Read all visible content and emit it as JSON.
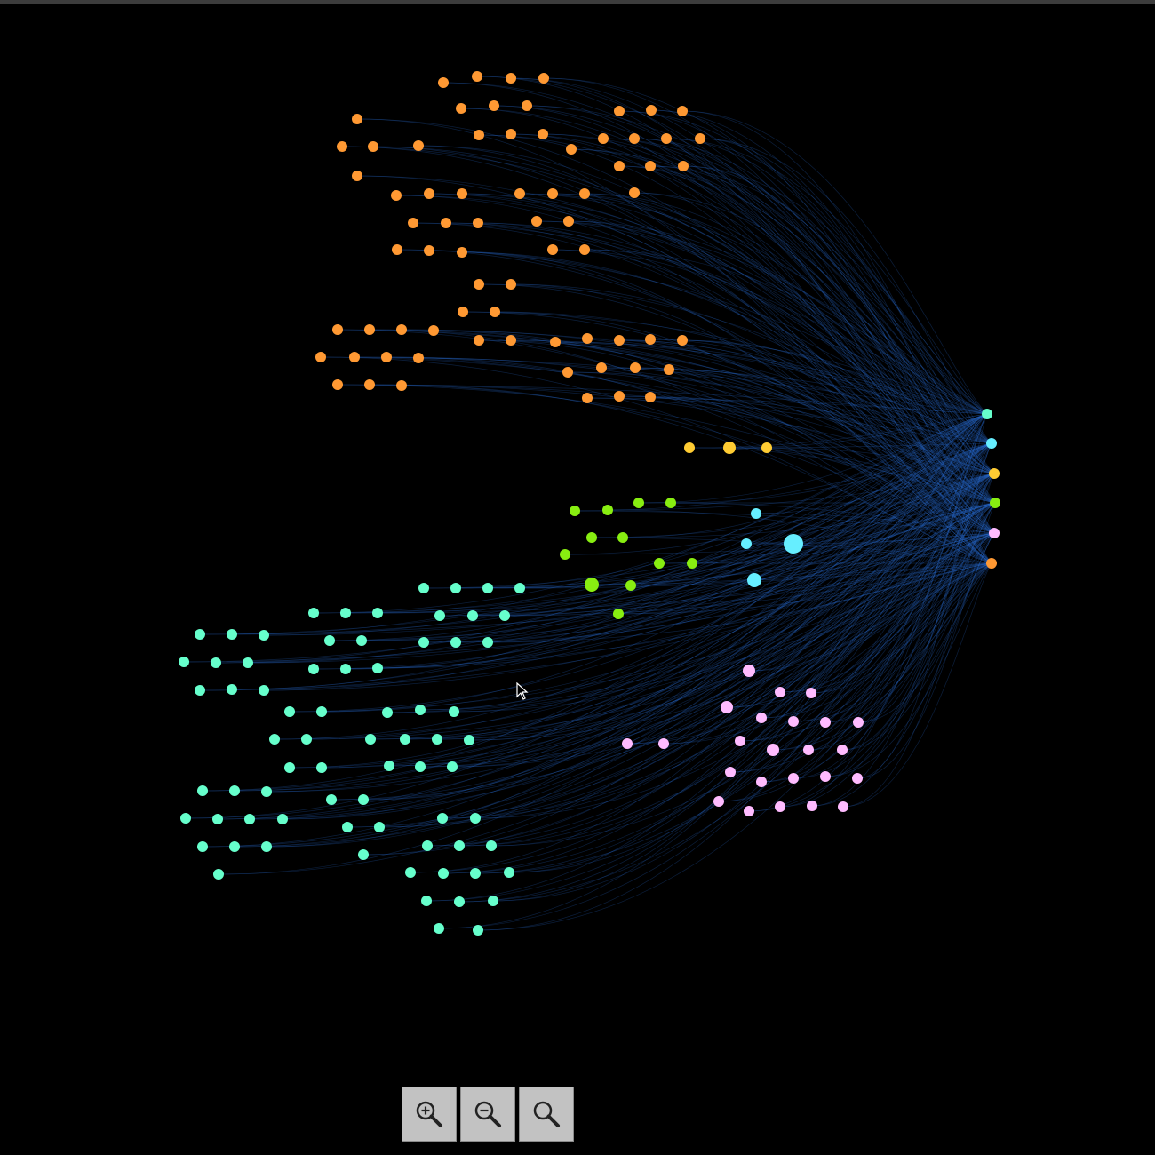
{
  "colors": {
    "background": "#000000",
    "edge": "#2a6fd6",
    "groups": {
      "orange": "#ff9933",
      "teal": "#66ffcc",
      "green": "#88ee11",
      "cyan": "#66eeff",
      "yellow": "#ffcc33",
      "pink": "#ffbbff"
    }
  },
  "toolbar": {
    "zoom_in": {
      "icon": "zoom-in-icon"
    },
    "zoom_out": {
      "icon": "zoom-out-icon"
    },
    "zoom_reset": {
      "icon": "zoom-reset-icon"
    }
  },
  "cursor": {
    "icon": "mouse-pointer-icon"
  }
}
